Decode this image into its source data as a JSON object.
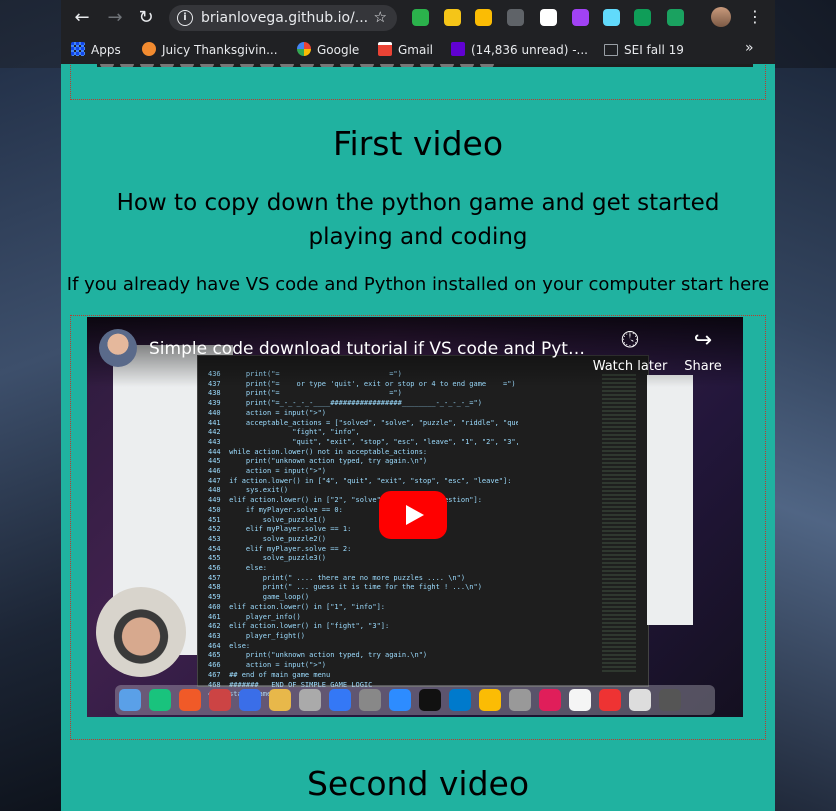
{
  "browser": {
    "url": "brianlovega.github.io/...",
    "bookmarks": [
      {
        "label": "Apps",
        "icon": "apps-grid-icon",
        "color": "#4285f4"
      },
      {
        "label": "Juicy Thanksgivin...",
        "icon": "juicy-icon",
        "color": "#f28b30"
      },
      {
        "label": "Google",
        "icon": "google-icon",
        "color": "#ffffff"
      },
      {
        "label": "Gmail",
        "icon": "gmail-icon",
        "color": "#ea4335"
      },
      {
        "label": "(14,836 unread) -...",
        "icon": "yahoo-mail-icon",
        "color": "#6001d2"
      },
      {
        "label": "SEI fall 19",
        "icon": "folder-icon",
        "color": "#9aa0a6"
      }
    ],
    "extension_colors": [
      "#2bb24c",
      "#f5c518",
      "#fbbc04",
      "#5f6368",
      "#ffffff",
      "#a142f4",
      "#61dafb",
      "#0f9d58",
      "#1aa260"
    ]
  },
  "page": {
    "first_video_heading": "First video",
    "first_video_subheading": "How to copy down the python game and get started playing and coding",
    "first_video_note": "If you already have VS code and Python installed on your computer start here",
    "second_video_heading": "Second video",
    "accent_color": "#20b2a0"
  },
  "video": {
    "title": "Simple code download tutorial if VS code and Python...",
    "watch_later_label": "Watch later",
    "share_label": "Share"
  }
}
